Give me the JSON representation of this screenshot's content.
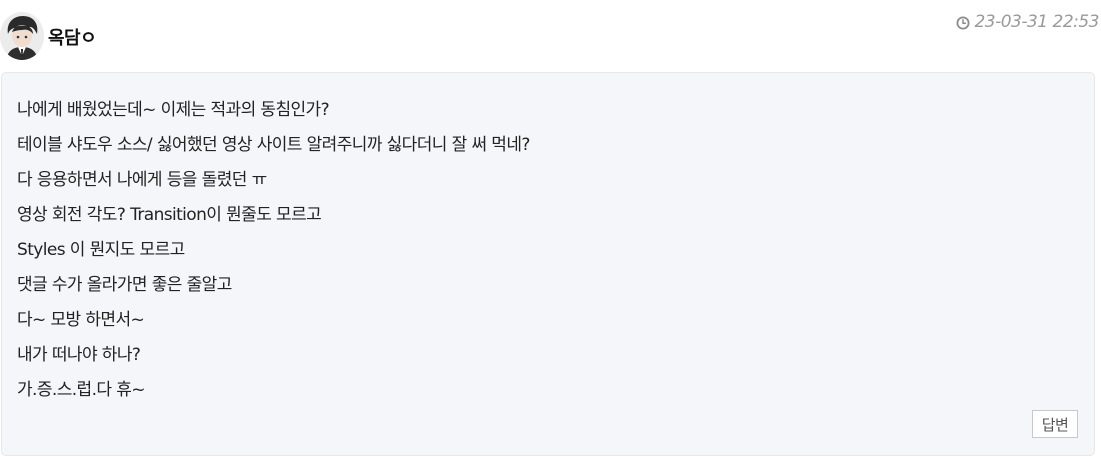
{
  "comment": {
    "author": "옥담ㅇ",
    "avatar_icon": "user-avatar-icon",
    "timestamp_icon": "clock-icon",
    "timestamp": "23-03-31 22:53",
    "lines": [
      "나에게 배웠었는데~ 이제는 적과의 동침인가?",
      "테이블 샤도우 소스/ 싫어했던 영상 사이트 알려주니까 싫다더니 잘 써 먹네?",
      "다 응용하면서 나에게 등을 돌렸던 ㅠ",
      "영상 회전 각도? Transition이 뭔줄도 모르고",
      "Styles 이 뭔지도 모르고",
      "댓글 수가 올라가면 좋은 줄알고",
      "다~ 모방 하면서~",
      "내가 떠나야 하나?",
      "가.증.스.럽.다 휴~"
    ],
    "reply_label": "답변"
  },
  "colors": {
    "box_background": "#f4f6f9",
    "box_border": "#e6e8ec",
    "timestamp_text": "#9a9a9a"
  }
}
